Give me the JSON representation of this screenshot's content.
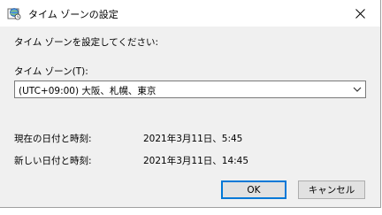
{
  "window": {
    "title": "タイム ゾーンの設定"
  },
  "dialog": {
    "instruction": "タイム ゾーンを設定してください:",
    "timezone_label": "タイム ゾーン(T):",
    "timezone_selected": "(UTC+09:00) 大阪、札幌、東京",
    "current_label": "現在の日付と時刻:",
    "current_value": "2021年3月11日、5:45",
    "new_label": "新しい日付と時刻:",
    "new_value": "2021年3月11日、14:45",
    "ok_label": "OK",
    "cancel_label": "キャンセル"
  },
  "icons": {
    "title": "globe-clock-icon",
    "close": "close-icon",
    "dropdown": "chevron-down-icon"
  },
  "colors": {
    "accent": "#0078d7",
    "dialog_bg": "#f0f0f0",
    "button_bg": "#e1e1e1"
  }
}
